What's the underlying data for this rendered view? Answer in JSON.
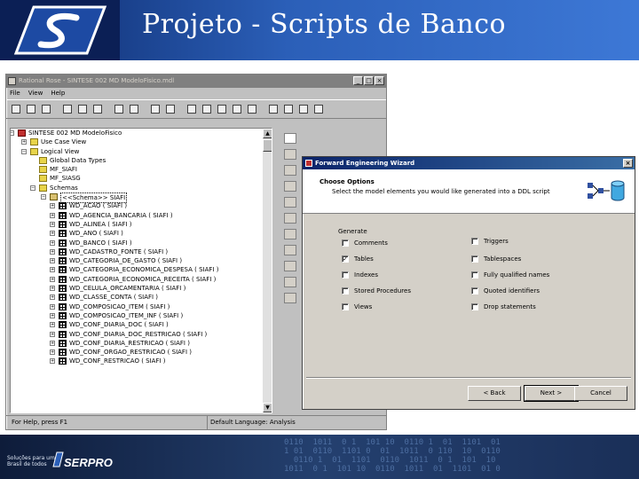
{
  "slide": {
    "title": "Projeto - Scripts de Banco",
    "footer_tagline": "Soluções para um Brasil de todos",
    "footer_brand": "SERPRO",
    "colors": {
      "header_dark": "#0d2a6b",
      "header_light": "#3d78d6",
      "footer": "#1a2f58"
    }
  },
  "rose": {
    "title": "Rational Rose - SINTESE 002 MD ModeloFisico.mdl",
    "menu": [
      "File",
      "View",
      "Help"
    ],
    "toolbar_icons": [
      "new-icon",
      "open-icon",
      "save-icon",
      "cut-icon",
      "copy-icon",
      "paste-icon",
      "print-icon",
      "context-help-icon",
      "window-icon",
      "browse-class-icon",
      "browse-interaction-icon",
      "browse-component-icon",
      "browse-deployment-icon",
      "browse-parent-icon",
      "browse-previous-icon",
      "zoom-in-icon",
      "zoom-out-icon",
      "fit-window-icon",
      "undo-fit-icon"
    ],
    "tree": {
      "root": "SINTESE 002 MD ModeloFisico",
      "use_case_view": "Use Case View",
      "logical_view": "Logical View",
      "global_data_types": "Global Data Types",
      "mf_siafi": "MF_SIAFI",
      "mf_siasg": "MF_SIASG",
      "schemas": "Schemas",
      "schema_siafi": "<<Schema>> SIAFI",
      "tables": [
        "WD_ACAO ( SIAFI )",
        "WD_AGENCIA_BANCARIA ( SIAFI )",
        "WD_ALINEA ( SIAFI )",
        "WD_ANO ( SIAFI )",
        "WD_BANCO ( SIAFI )",
        "WD_CADASTRO_FONTE ( SIAFI )",
        "WD_CATEGORIA_DE_GASTO ( SIAFI )",
        "WD_CATEGORIA_ECONOMICA_DESPESA ( SIAFI )",
        "WD_CATEGORIA_ECONOMICA_RECEITA ( SIAFI )",
        "WD_CELULA_ORCAMENTARIA ( SIAFI )",
        "WD_CLASSE_CONTA ( SIAFI )",
        "WD_COMPOSICAO_ITEM ( SIAFI )",
        "WD_COMPOSICAO_ITEM_INF ( SIAFI )",
        "WD_CONF_DIARIA_DOC ( SIAFI )",
        "WD_CONF_DIARIA_DOC_RESTRICAO ( SIAFI )",
        "WD_CONF_DIARIA_RESTRICAO ( SIAFI )",
        "WD_CONF_ORGAO_RESTRICAO ( SIAFI )",
        "WD_CONF_RESTRICAO ( SIAFI )"
      ]
    },
    "status_left": "For Help, press F1",
    "status_right": "Default Language: Analysis"
  },
  "wizard": {
    "title": "Forward Engineering Wizard",
    "heading": "Choose Options",
    "subheading": "Select the model elements you would like generated into a DDL script",
    "generate_label": "Generate",
    "options_left": [
      {
        "label": "Comments",
        "checked": ""
      },
      {
        "label": "Tables",
        "checked": "✓"
      },
      {
        "label": "Indexes",
        "checked": ""
      },
      {
        "label": "Stored Procedures",
        "checked": ""
      },
      {
        "label": "Views",
        "checked": ""
      }
    ],
    "options_right": [
      {
        "label": "Triggers",
        "checked": ""
      },
      {
        "label": "Tablespaces",
        "checked": ""
      },
      {
        "label": "Fully qualified names",
        "checked": ""
      },
      {
        "label": "Quoted identifiers",
        "checked": ""
      },
      {
        "label": "Drop statements",
        "checked": ""
      }
    ],
    "buttons": {
      "back": "< Back",
      "next": "Next >",
      "cancel": "Cancel"
    }
  }
}
